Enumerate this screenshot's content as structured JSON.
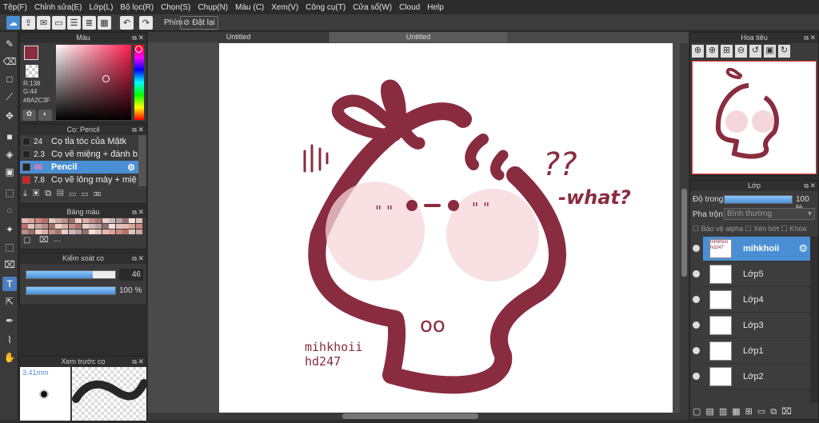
{
  "menu": [
    "Tệp(F)",
    "Chỉnh sửa(E)",
    "Lớp(L)",
    "Bộ lọc(R)",
    "Chọn(S)",
    "Chụp(N)",
    "Màu (C)",
    "Xem(V)",
    "Công cụ(T)",
    "Cửa sổ(W)",
    "Cloud",
    "Help"
  ],
  "toolbar": {
    "shortcut_label": "Phím",
    "reset_label": "Đặt lại"
  },
  "color_panel": {
    "title": "Màu",
    "r": "R:138",
    "g": "G:44",
    "hex": "#8A2C3F",
    "main_color": "#8a2c3f"
  },
  "brush_panel": {
    "title": "Cọ: Pencil",
    "items": [
      {
        "size": "24",
        "name": "Cọ tỉa tóc của Mậtk"
      },
      {
        "size": "2.3",
        "name": "Cọ vẽ miệng + đánh b"
      },
      {
        "size": "46",
        "name": "Pencil"
      },
      {
        "size": "7.8",
        "name": "Cọ vẽ lông mày + miệ"
      }
    ]
  },
  "palette_panel": {
    "title": "Bảng màu",
    "dash": "---"
  },
  "brush_control": {
    "title": "Kiểm soát cọ",
    "size": "46",
    "opacity": "100 %"
  },
  "preview_panel": {
    "title": "Xem trước cọ",
    "size": "3.41mm"
  },
  "tabs": [
    "Untitled",
    "Untitled"
  ],
  "navigator": {
    "title": "Hoa tiêu"
  },
  "layers_panel": {
    "title": "Lớp",
    "opacity_label": "Độ trong",
    "opacity_value": "100 %",
    "blend_label": "Pha trộn",
    "blend_value": "Bình thường",
    "opt_alpha": "Bảo vệ alpha",
    "opt_clip": "Xén bớt",
    "opt_lock": "Khóa",
    "layers": [
      {
        "name": "mihkhoii"
      },
      {
        "name": "Lớp5"
      },
      {
        "name": "Lớp4"
      },
      {
        "name": "Lớp3"
      },
      {
        "name": "Lớp1"
      },
      {
        "name": "Lớp2"
      }
    ]
  },
  "canvas": {
    "question": "??",
    "what": "-what?",
    "sig1": "mihkhoii",
    "sig2": "hd247",
    "eyes": "• – •",
    "cheeks": "\" \"",
    "mouth": "oo"
  }
}
